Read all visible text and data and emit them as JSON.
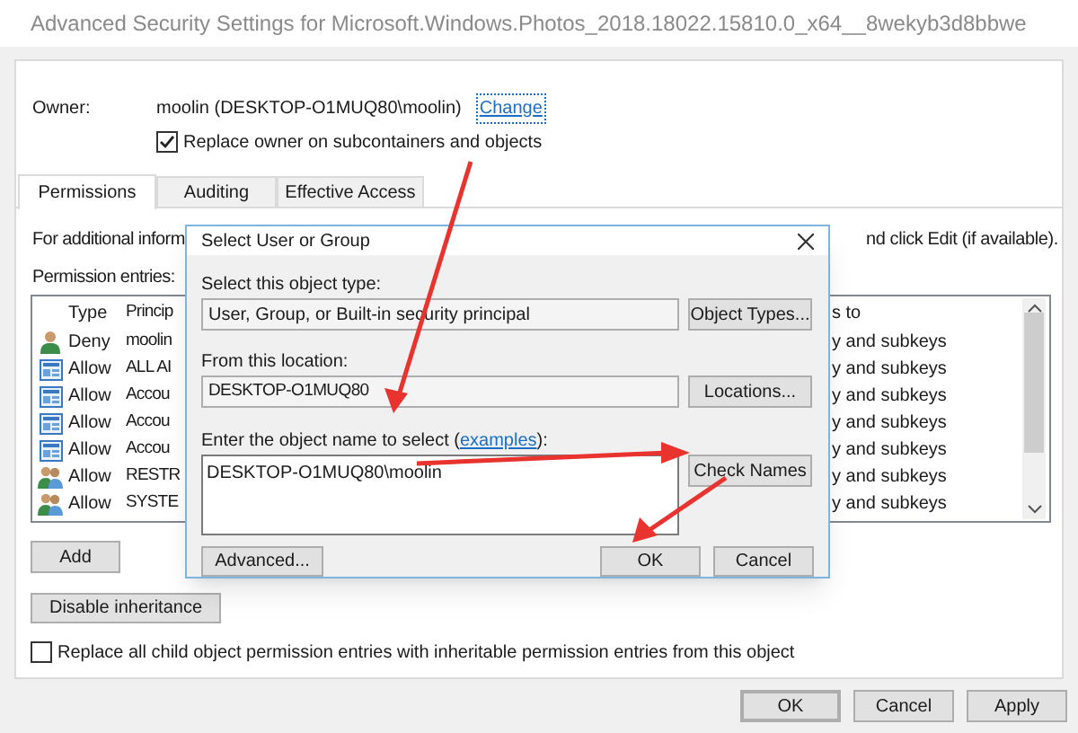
{
  "window": {
    "title": "Advanced Security Settings for Microsoft.Windows.Photos_2018.18022.15810.0_x64__8wekyb3d8bbwe"
  },
  "owner": {
    "label": "Owner:",
    "value": "moolin (DESKTOP-O1MUQ80\\moolin)",
    "change_link": "Change"
  },
  "replace_owner": {
    "label": "Replace owner on subcontainers and objects",
    "checked": true
  },
  "tabs": [
    {
      "label": "Permissions",
      "selected": true
    },
    {
      "label": "Auditing",
      "selected": false
    },
    {
      "label": "Effective Access",
      "selected": false
    }
  ],
  "info_text": "For additional inform",
  "info_text_end": "nd click Edit (if available).",
  "permission_entries_label": "Permission entries:",
  "entries": {
    "columns": [
      "Type",
      "Princip",
      "s to"
    ],
    "rows": [
      {
        "kind": "user",
        "type": "Deny",
        "principal": "moolin",
        "applies_to": "y and subkeys"
      },
      {
        "kind": "package",
        "type": "Allow",
        "principal": "ALL AI",
        "applies_to": "y and subkeys"
      },
      {
        "kind": "package",
        "type": "Allow",
        "principal": "Accou",
        "applies_to": "y and subkeys"
      },
      {
        "kind": "package",
        "type": "Allow",
        "principal": "Accou",
        "applies_to": "y and subkeys"
      },
      {
        "kind": "package",
        "type": "Allow",
        "principal": "Accou",
        "applies_to": "y and subkeys"
      },
      {
        "kind": "group",
        "type": "Allow",
        "principal": "RESTR",
        "applies_to": "y and subkeys"
      },
      {
        "kind": "group",
        "type": "Allow",
        "principal": "SYSTE",
        "applies_to": "y and subkeys"
      }
    ]
  },
  "add_button": "Add",
  "disable_inheritance_button": "Disable inheritance",
  "replace_child": {
    "label": "Replace all child object permission entries with inheritable permission entries from this object",
    "checked": false
  },
  "footer_buttons": [
    {
      "label": "OK",
      "default": true
    },
    {
      "label": "Cancel",
      "default": false
    },
    {
      "label": "Apply",
      "default": false
    }
  ],
  "dialog": {
    "title": "Select User or Group",
    "object_type_label": "Select this object type:",
    "object_type": "User, Group, or Built-in security principal",
    "object_types_button": "Object Types...",
    "location_label": "From this location:",
    "location": "DESKTOP-O1MUQ80",
    "locations_button": "Locations...",
    "name_label": "Enter the object name to select (",
    "examples_link": "examples",
    "name_label_end": "):",
    "name_value": "DESKTOP-O1MUQ80\\moolin",
    "check_names_button": "Check Names",
    "advanced_button": "Advanced...",
    "ok_button": "OK",
    "cancel_button": "Cancel"
  }
}
